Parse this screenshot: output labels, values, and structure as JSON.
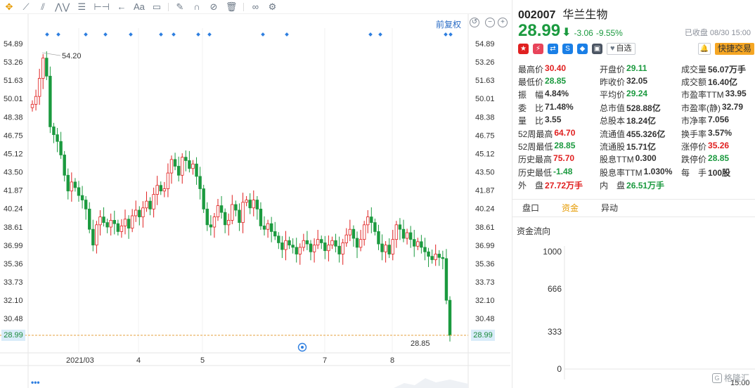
{
  "toolbar": {
    "tools": [
      "crosshair-tool-icon",
      "trendline-tool-icon",
      "channel-tool-icon",
      "wave-tool-icon",
      "fibonacci-tool-icon",
      "range-tool-icon",
      "undo-arrow-icon",
      "text-tool-icon",
      "comment-tool-icon",
      "pen-tool-icon",
      "magnet-icon",
      "hide-icon",
      "delete-icon",
      "link-icon",
      "gear-icon"
    ],
    "text_label": "Aa"
  },
  "chart": {
    "restore_label": "前复权",
    "high_marker": "54.20",
    "low_marker": "28.85",
    "current_price_tag": "28.99"
  },
  "chart_data": {
    "type": "candlestick",
    "y_ticks": [
      "54.89",
      "53.26",
      "51.63",
      "50.01",
      "48.38",
      "46.75",
      "45.12",
      "43.50",
      "41.87",
      "40.24",
      "38.61",
      "36.99",
      "35.36",
      "33.73",
      "32.10",
      "30.48",
      "28.99"
    ],
    "x_ticks": [
      "2021/03",
      "4",
      "5",
      "7",
      "8"
    ],
    "ylim": [
      28.99,
      54.89
    ],
    "highest": 54.2,
    "lowest": 28.85,
    "last": 28.99,
    "closes": [
      49.5,
      50.2,
      51.8,
      53.6,
      52.0,
      47.5,
      46.8,
      46.2,
      45.0,
      43.2,
      41.8,
      42.6,
      42.1,
      41.4,
      41.0,
      40.2,
      38.4,
      37.0,
      38.8,
      39.5,
      39.0,
      38.6,
      39.2,
      38.9,
      38.2,
      38.7,
      39.3,
      38.5,
      39.6,
      40.1,
      39.5,
      40.3,
      40.9,
      40.2,
      41.5,
      42.3,
      41.8,
      42.0,
      43.4,
      44.6,
      44.0,
      43.2,
      44.8,
      44.5,
      43.8,
      44.2,
      43.1,
      42.0,
      40.2,
      38.8,
      38.6,
      39.5,
      40.5,
      39.9,
      38.8,
      39.2,
      40.6,
      40.1,
      39.0,
      40.8,
      41.0,
      40.3,
      41.0,
      40.2,
      38.7,
      38.4,
      38.9,
      38.2,
      37.8,
      37.2,
      36.6,
      37.4,
      37.0,
      36.8,
      36.2,
      36.8,
      37.4,
      37.1,
      36.4,
      37.0,
      37.5,
      37.2,
      36.5,
      37.0,
      37.4,
      36.9,
      36.2,
      37.2,
      37.9,
      38.4,
      37.6,
      36.8,
      37.5,
      38.8,
      39.5,
      39.0,
      38.2,
      37.1,
      36.4,
      37.0,
      36.2,
      37.5,
      38.8,
      38.4,
      37.6,
      38.1,
      37.5,
      36.9,
      37.3,
      36.8,
      36.4,
      36.0,
      35.7,
      36.2,
      35.9,
      35.8,
      32.1,
      28.99
    ],
    "volume_x_ticks": [
      "15:00"
    ]
  },
  "quote": {
    "code": "002007",
    "name": "华兰生物",
    "price": "28.99",
    "change": "-3.06",
    "change_pct": "-9.55%",
    "status": "已收盘 08/30 15:00",
    "badges": [
      {
        "icon": "china-flag-icon",
        "color": "#e02020",
        "glyph": "★"
      },
      {
        "icon": "lightning-icon",
        "color": "#e8445a",
        "glyph": "⚡"
      },
      {
        "icon": "shuffle-icon",
        "color": "#1a7fe6",
        "glyph": "⇄"
      },
      {
        "icon": "dollar-icon",
        "color": "#1a7fe6",
        "glyph": "S"
      },
      {
        "icon": "tag-icon",
        "color": "#1a7fe6",
        "glyph": "◆"
      },
      {
        "icon": "book-icon",
        "color": "#4b5563",
        "glyph": "▣"
      }
    ],
    "watch_label": "自选",
    "trade_label": "快捷交易",
    "rows": [
      [
        {
          "l": "最高价",
          "v": "30.40",
          "c": "up"
        },
        {
          "l": "开盘价",
          "v": "29.11",
          "c": "down"
        },
        {
          "l": "成交量",
          "v": "56.07万手",
          "c": "neu"
        }
      ],
      [
        {
          "l": "最低价",
          "v": "28.85",
          "c": "down"
        },
        {
          "l": "昨收价",
          "v": "32.05",
          "c": "neu"
        },
        {
          "l": "成交额",
          "v": "16.40亿",
          "c": "neu"
        }
      ],
      [
        {
          "l": "振　幅",
          "v": "4.84%",
          "c": "neu"
        },
        {
          "l": "平均价",
          "v": "29.24",
          "c": "down"
        },
        {
          "l": "市盈率TTM",
          "v": "33.95",
          "c": "neu"
        }
      ],
      [
        {
          "l": "委　比",
          "v": "71.48%",
          "c": "neu"
        },
        {
          "l": "总市值",
          "v": "528.88亿",
          "c": "neu"
        },
        {
          "l": "市盈率(静)",
          "v": "32.79",
          "c": "neu"
        }
      ],
      [
        {
          "l": "量　比",
          "v": "3.55",
          "c": "neu"
        },
        {
          "l": "总股本",
          "v": "18.24亿",
          "c": "neu"
        },
        {
          "l": "市净率",
          "v": "7.056",
          "c": "neu"
        }
      ],
      [
        {
          "l": "52周最高",
          "v": "64.70",
          "c": "up"
        },
        {
          "l": "流通值",
          "v": "455.326亿",
          "c": "neu"
        },
        {
          "l": "换手率",
          "v": "3.57%",
          "c": "neu"
        }
      ],
      [
        {
          "l": "52周最低",
          "v": "28.85",
          "c": "down"
        },
        {
          "l": "流通股",
          "v": "15.71亿",
          "c": "neu"
        },
        {
          "l": "涨停价",
          "v": "35.26",
          "c": "up"
        }
      ],
      [
        {
          "l": "历史最高",
          "v": "75.70",
          "c": "up"
        },
        {
          "l": "股息TTM",
          "v": "0.300",
          "c": "neu"
        },
        {
          "l": "跌停价",
          "v": "28.85",
          "c": "down"
        }
      ],
      [
        {
          "l": "历史最低",
          "v": "-1.48",
          "c": "down"
        },
        {
          "l": "股息率TTM",
          "v": "1.030%",
          "c": "neu"
        },
        {
          "l": "每　手",
          "v": "100股",
          "c": "neu"
        }
      ],
      [
        {
          "l": "外　盘",
          "v": "27.72万手",
          "c": "up"
        },
        {
          "l": "内　盘",
          "v": "26.51万手",
          "c": "down"
        },
        {
          "l": "",
          "v": "",
          "c": "neu"
        }
      ]
    ],
    "tabs": [
      "盘口",
      "资金",
      "异动"
    ],
    "active_tab": 1,
    "fund_title": "资金流向",
    "fund_y_ticks": [
      "1000",
      "666",
      "333",
      "0"
    ],
    "watermark": "格隆汇"
  }
}
